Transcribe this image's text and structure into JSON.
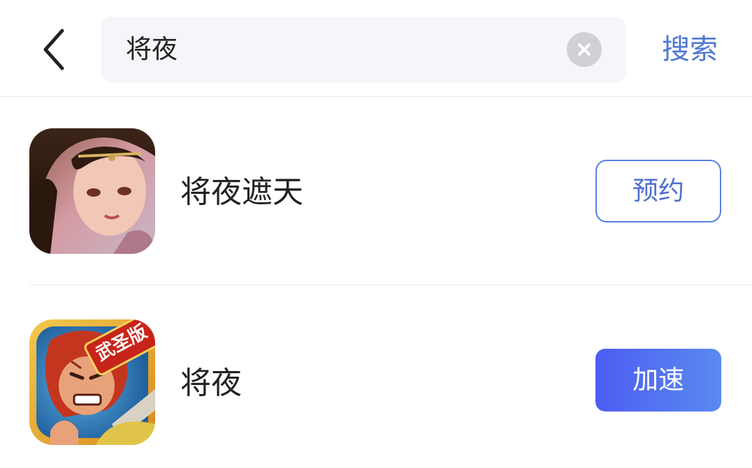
{
  "header": {
    "back_icon": "chevron-left-icon",
    "search": {
      "value": "将夜",
      "clear_icon": "clear-circle-icon"
    },
    "search_button_label": "搜索"
  },
  "results": [
    {
      "name": "将夜遮天",
      "action_label": "预约",
      "action_style": "outline"
    },
    {
      "name": "将夜",
      "badge_text": "武圣版",
      "action_label": "加速",
      "action_style": "filled"
    }
  ],
  "colors": {
    "accent": "#4d77d4",
    "outline_button": "#5b7fe3",
    "filled_button_start": "#4d5df3",
    "filled_button_end": "#5a8af0",
    "search_bg": "#f4f6f9"
  }
}
